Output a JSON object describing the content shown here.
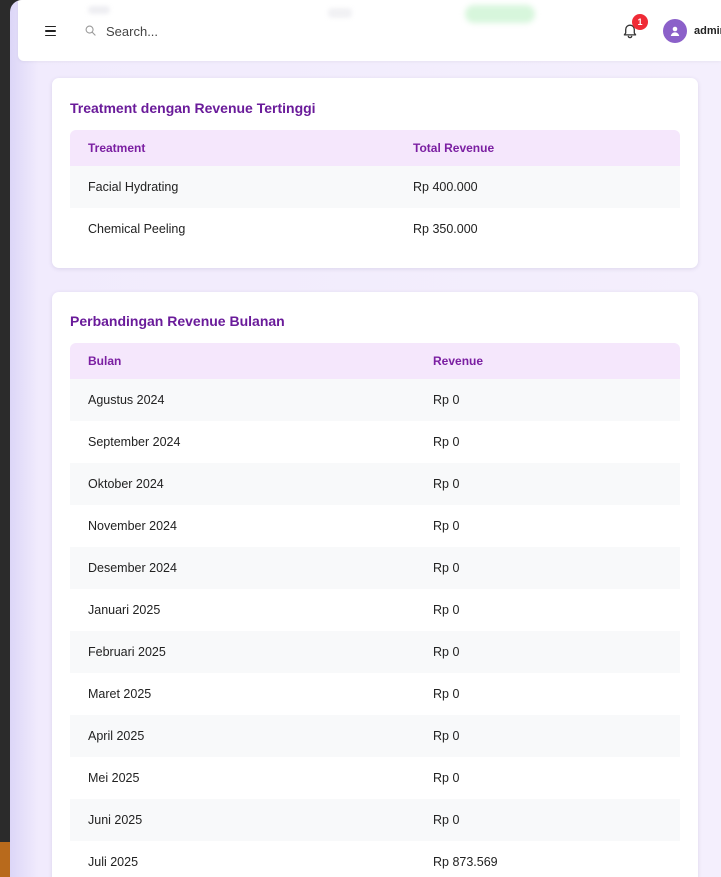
{
  "header": {
    "search_placeholder": "Search...",
    "notification_count": "1",
    "username": "admin"
  },
  "top_treatments": {
    "title": "Treatment dengan Revenue Tertinggi",
    "columns": [
      "Treatment",
      "Total Revenue"
    ],
    "rows": [
      [
        "Facial Hydrating",
        "Rp 400.000"
      ],
      [
        "Chemical Peeling",
        "Rp 350.000"
      ]
    ]
  },
  "monthly_revenue": {
    "title": "Perbandingan Revenue Bulanan",
    "columns": [
      "Bulan",
      "Revenue"
    ],
    "rows": [
      [
        "Agustus 2024",
        "Rp 0"
      ],
      [
        "September 2024",
        "Rp 0"
      ],
      [
        "Oktober 2024",
        "Rp 0"
      ],
      [
        "November 2024",
        "Rp 0"
      ],
      [
        "Desember 2024",
        "Rp 0"
      ],
      [
        "Januari 2025",
        "Rp 0"
      ],
      [
        "Februari 2025",
        "Rp 0"
      ],
      [
        "Maret 2025",
        "Rp 0"
      ],
      [
        "April 2025",
        "Rp 0"
      ],
      [
        "Mei 2025",
        "Rp 0"
      ],
      [
        "Juni 2025",
        "Rp 0"
      ],
      [
        "Juli 2025",
        "Rp 873.569"
      ]
    ]
  },
  "colors": {
    "accent": "#6a1b9a",
    "table_header_bg": "#f5e7fc",
    "badge": "#ef2b36",
    "avatar": "#8b60c9"
  },
  "icons": {
    "menu": "hamburger-menu-icon",
    "search": "search-icon",
    "notification": "bell-icon",
    "user": "user-icon"
  }
}
